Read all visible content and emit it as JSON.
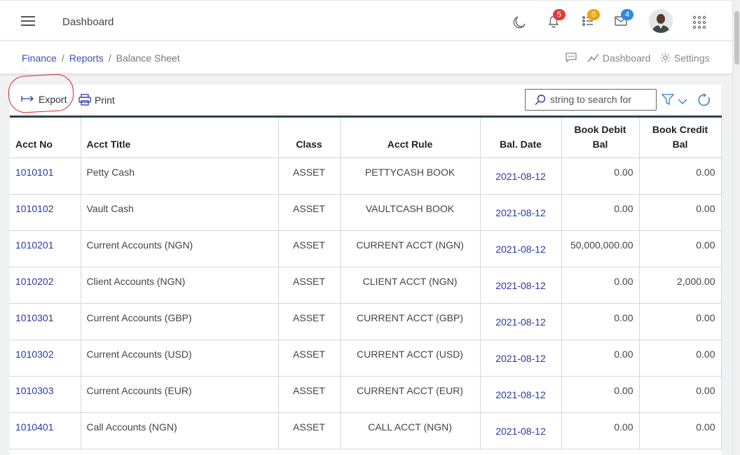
{
  "header": {
    "title": "Dashboard",
    "notifications_count": "5",
    "tasks_count": "0",
    "messages_count": "4",
    "badge_colors": {
      "notifications": "#e03b3b",
      "tasks": "#f0a30a",
      "messages": "#2f8ae5"
    }
  },
  "breadcrumb": {
    "items": [
      "Finance",
      "Reports"
    ],
    "current": "Balance Sheet"
  },
  "page_actions": {
    "dashboard_label": "Dashboard",
    "settings_label": "Settings"
  },
  "toolbar": {
    "export_label": "Export",
    "print_label": "Print",
    "search_placeholder": "string to search for"
  },
  "table": {
    "headers": [
      "Acct No",
      "Acct Title",
      "Class",
      "Acct Rule",
      "Bal. Date",
      "Book Debit Bal",
      "Book Credit Bal"
    ],
    "rows": [
      [
        "1010101",
        "Petty Cash",
        "ASSET",
        "PETTYCASH BOOK",
        "2021-08-12",
        "0.00",
        "0.00"
      ],
      [
        "1010102",
        "Vault Cash",
        "ASSET",
        "VAULTCASH BOOK",
        "2021-08-12",
        "0.00",
        "0.00"
      ],
      [
        "1010201",
        "Current Accounts (NGN)",
        "ASSET",
        "CURRENT ACCT (NGN)",
        "2021-08-12",
        "50,000,000.00",
        "0.00"
      ],
      [
        "1010202",
        "Client Accounts (NGN)",
        "ASSET",
        "CLIENT ACCT (NGN)",
        "2021-08-12",
        "0.00",
        "2,000.00"
      ],
      [
        "1010301",
        "Current Accounts (GBP)",
        "ASSET",
        "CURRENT ACCT (GBP)",
        "2021-08-12",
        "0.00",
        "0.00"
      ],
      [
        "1010302",
        "Current Accounts (USD)",
        "ASSET",
        "CURRENT ACCT (USD)",
        "2021-08-12",
        "0.00",
        "0.00"
      ],
      [
        "1010303",
        "Current Accounts (EUR)",
        "ASSET",
        "CURRENT ACCT (EUR)",
        "2021-08-12",
        "0.00",
        "0.00"
      ],
      [
        "1010401",
        "Call Accounts (NGN)",
        "ASSET",
        "CALL ACCT (NGN)",
        "2021-08-12",
        "0.00",
        "0.00"
      ]
    ]
  }
}
